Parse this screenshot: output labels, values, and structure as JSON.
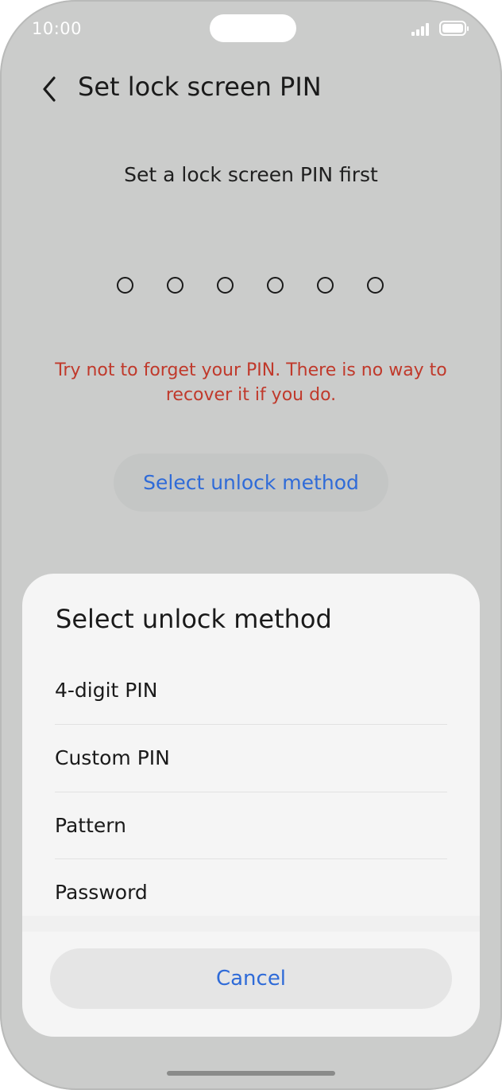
{
  "status_bar": {
    "time": "10:00"
  },
  "header": {
    "title": "Set lock screen PIN"
  },
  "main": {
    "subtitle": "Set a lock screen PIN first",
    "pin_length": 6,
    "warning": "Try not to forget your PIN. There is no way to recover it if you do.",
    "select_button_label": "Select unlock method"
  },
  "sheet": {
    "title": "Select unlock method",
    "options": [
      {
        "label": "4-digit PIN"
      },
      {
        "label": "Custom PIN"
      },
      {
        "label": "Pattern"
      },
      {
        "label": "Password"
      }
    ],
    "cancel_label": "Cancel"
  },
  "colors": {
    "accent": "#2f6bd8",
    "warning": "#c0392b",
    "dimmed_background": "#cbcccb",
    "sheet": "#f5f5f5"
  }
}
